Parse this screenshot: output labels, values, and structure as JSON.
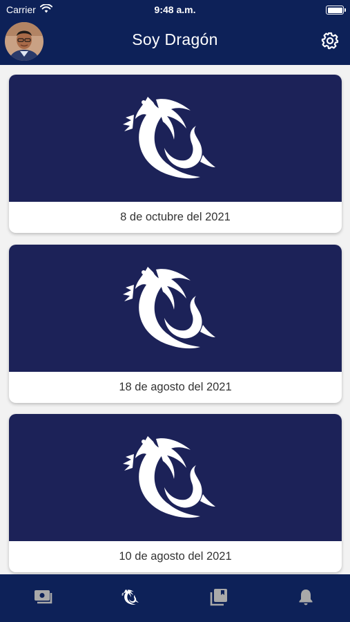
{
  "status_bar": {
    "carrier": "Carrier",
    "time": "9:48 a.m."
  },
  "header": {
    "title": "Soy Dragón",
    "settings_icon": "gear-icon",
    "background": "#0d2158"
  },
  "feed": {
    "cards": [
      {
        "date": "8 de octubre del 2021",
        "image": "dragon-logo"
      },
      {
        "date": "18 de agosto del 2021",
        "image": "dragon-logo"
      },
      {
        "date": "10 de agosto del 2021",
        "image": "dragon-logo"
      }
    ]
  },
  "tab_bar": {
    "tabs": [
      {
        "icon": "photo-stack-icon",
        "active": false
      },
      {
        "icon": "dragon-icon",
        "active": true
      },
      {
        "icon": "library-icon",
        "active": false
      },
      {
        "icon": "bell-icon",
        "active": false
      }
    ],
    "active_color": "#ffffff",
    "inactive_color": "#a9a9a9"
  }
}
